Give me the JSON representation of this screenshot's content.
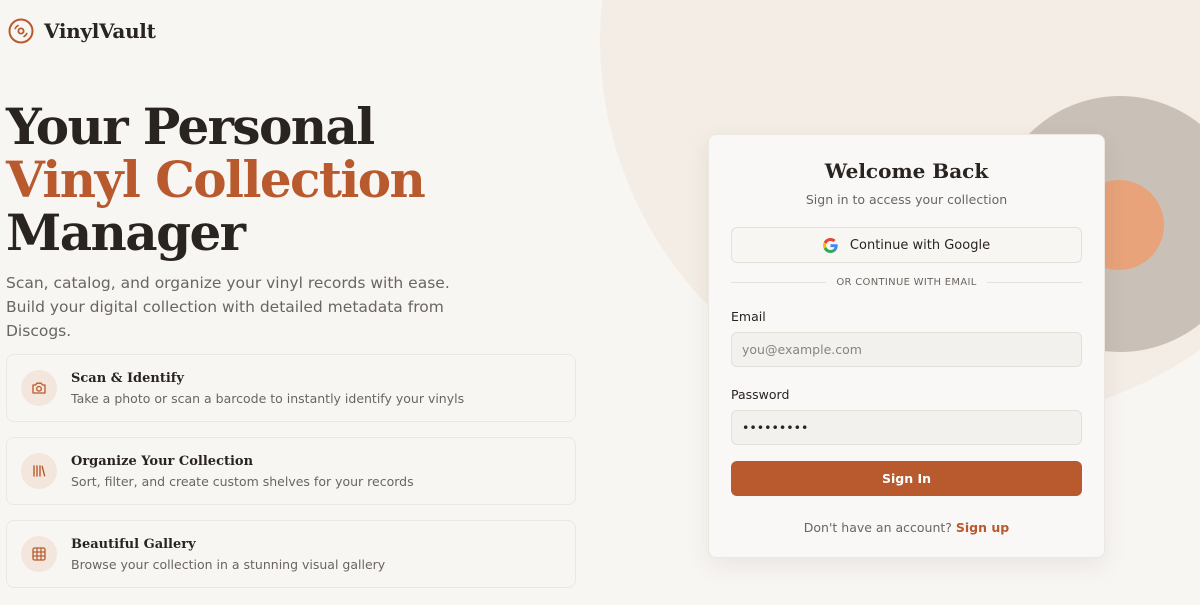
{
  "brand": {
    "name": "VinylVault",
    "icon": "vinyl-record-icon"
  },
  "hero": {
    "title_line1": "Your Personal",
    "title_line2": "Vinyl Collection",
    "title_line3": "Manager",
    "subtitle": "Scan, catalog, and organize your vinyl records with ease. Build your digital collection with detailed metadata from Discogs."
  },
  "features": [
    {
      "icon": "camera-icon",
      "title": "Scan & Identify",
      "desc": "Take a photo or scan a barcode to instantly identify your vinyls"
    },
    {
      "icon": "library-icon",
      "title": "Organize Your Collection",
      "desc": "Sort, filter, and create custom shelves for your records"
    },
    {
      "icon": "grid-icon",
      "title": "Beautiful Gallery",
      "desc": "Browse your collection in a stunning visual gallery"
    }
  ],
  "login": {
    "title": "Welcome Back",
    "subtitle": "Sign in to access your collection",
    "google_label": "Continue with Google",
    "divider": "OR CONTINUE WITH EMAIL",
    "email_label": "Email",
    "email_placeholder": "you@example.com",
    "email_value": "",
    "password_label": "Password",
    "password_value": "•••••••••",
    "signin_label": "Sign In",
    "signup_prompt": "Don't have an account?",
    "signup_link": "Sign up"
  },
  "colors": {
    "accent": "#b85a2e",
    "background": "#f8f6f3",
    "text": "#2a2420",
    "muted": "#6b6560"
  }
}
